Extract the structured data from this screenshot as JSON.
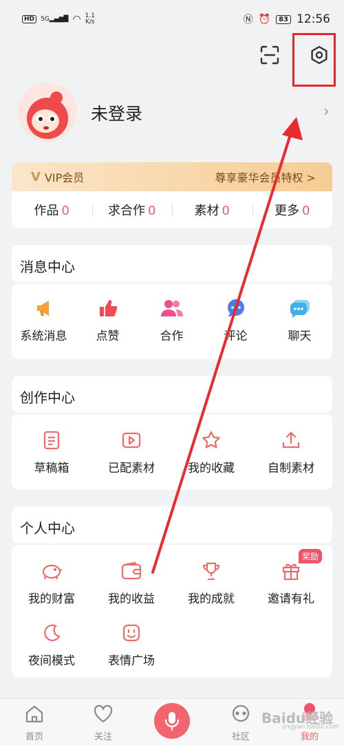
{
  "status_bar": {
    "hd": "HD",
    "net_speed": "1.1",
    "net_unit": "K/s",
    "battery": "83",
    "time": "12:56",
    "signal": "5G"
  },
  "profile": {
    "login_label": "未登录"
  },
  "vip": {
    "label": "VIP会员",
    "link": "尊享豪华会员特权 >"
  },
  "stats": [
    {
      "label": "作品",
      "value": "0"
    },
    {
      "label": "求合作",
      "value": "0"
    },
    {
      "label": "素材",
      "value": "0"
    },
    {
      "label": "更多",
      "value": "0"
    }
  ],
  "message_center": {
    "title": "消息中心",
    "items": [
      {
        "label": "系统消息",
        "icon": "megaphone-icon"
      },
      {
        "label": "点赞",
        "icon": "thumbs-up-icon"
      },
      {
        "label": "合作",
        "icon": "users-icon"
      },
      {
        "label": "评论",
        "icon": "comment-icon"
      },
      {
        "label": "聊天",
        "icon": "chat-icon"
      }
    ]
  },
  "creation_center": {
    "title": "创作中心",
    "items": [
      {
        "label": "草稿箱",
        "icon": "draft-icon"
      },
      {
        "label": "已配素材",
        "icon": "video-icon"
      },
      {
        "label": "我的收藏",
        "icon": "star-icon"
      },
      {
        "label": "自制素材",
        "icon": "upload-icon"
      }
    ]
  },
  "personal_center": {
    "title": "个人中心",
    "reward_badge": "奖励",
    "items": [
      {
        "label": "我的财富",
        "icon": "piggy-bank-icon"
      },
      {
        "label": "我的收益",
        "icon": "wallet-icon"
      },
      {
        "label": "我的成就",
        "icon": "trophy-icon"
      },
      {
        "label": "邀请有礼",
        "icon": "gift-icon"
      },
      {
        "label": "夜间模式",
        "icon": "moon-icon"
      },
      {
        "label": "表情广场",
        "icon": "emoji-icon"
      }
    ]
  },
  "bottom_nav": [
    {
      "label": "首页",
      "icon": "home-icon"
    },
    {
      "label": "关注",
      "icon": "heart-icon"
    },
    {
      "label": "社区",
      "icon": "community-icon"
    },
    {
      "label": "我的",
      "icon": "profile-icon"
    }
  ],
  "watermark": {
    "text": "Baidu经验",
    "sub": "jingyan.baidu.com"
  },
  "colors": {
    "accent": "#f15c6a",
    "highlight_box": "#e8262b",
    "background": "#f1f2f4"
  }
}
